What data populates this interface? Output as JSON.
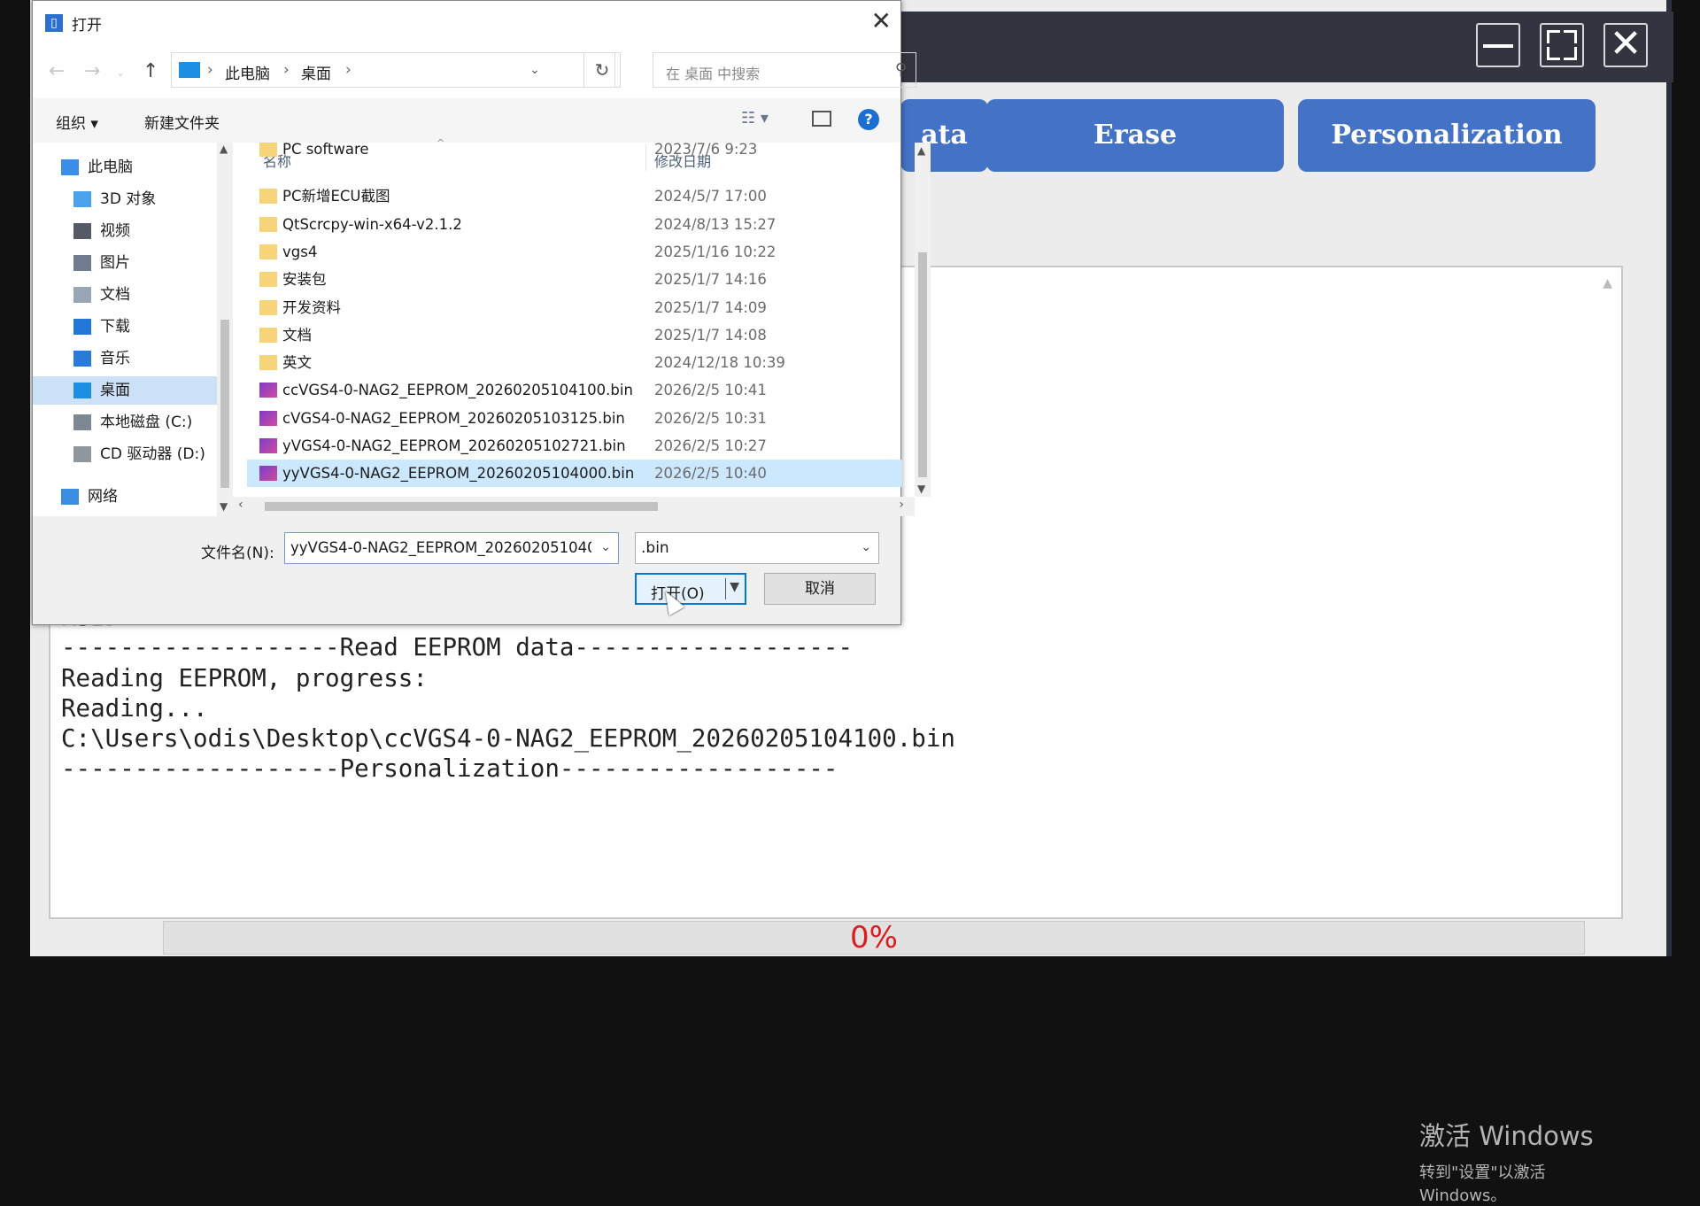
{
  "app": {
    "buttons": [
      {
        "label": "ata"
      },
      {
        "label": "Erase"
      },
      {
        "label": "Personalization"
      }
    ],
    "log_lines": [
      "RSID:            .....................................",
      "-------------------Read EEPROM data-------------------",
      "Reading EEPROM, progress:",
      "Reading...",
      "C:\\Users\\odis\\Desktop\\ccVGS4-0-NAG2_EEPROM_20260205104100.bin",
      "-------------------Personalization-------------------"
    ],
    "watermark": {
      "line1": "激活 Windows",
      "line2": "转到\"设置\"以激活 Windows。"
    },
    "progress": {
      "label": "0%",
      "value": 0
    }
  },
  "dialog": {
    "title": "打开",
    "breadcrumb": [
      "此电脑",
      "桌面"
    ],
    "search_placeholder": "在 桌面 中搜索",
    "toolbar": {
      "organize": "组织 ▾",
      "new_folder": "新建文件夹"
    },
    "nav_items": [
      {
        "label": "此电脑",
        "icon": "computer-icon",
        "color": "#3a8ee6"
      },
      {
        "label": "3D 对象",
        "icon": "cube-icon",
        "color": "#4aa3ea"
      },
      {
        "label": "视频",
        "icon": "video-icon",
        "color": "#555a66"
      },
      {
        "label": "图片",
        "icon": "picture-icon",
        "color": "#6f7d8e"
      },
      {
        "label": "文档",
        "icon": "document-icon",
        "color": "#9aa6b5"
      },
      {
        "label": "下载",
        "icon": "download-icon",
        "color": "#2277d8"
      },
      {
        "label": "音乐",
        "icon": "music-icon",
        "color": "#2a7ad8"
      },
      {
        "label": "桌面",
        "icon": "desktop-icon",
        "color": "#1e8ee3"
      },
      {
        "label": "本地磁盘 (C:)",
        "icon": "disk-icon",
        "color": "#7e8894"
      },
      {
        "label": "CD 驱动器 (D:)",
        "icon": "cd-drive-icon",
        "color": "#8f969e"
      },
      {
        "label": "网络",
        "icon": "network-icon",
        "color": "#3b8de0"
      }
    ],
    "columns": {
      "name": "名称",
      "date": "修改日期"
    },
    "files": [
      {
        "name": "PC software",
        "date": "2023/7/6 9:23",
        "type": "folder"
      },
      {
        "name": "PC新增ECU截图",
        "date": "2024/5/7 17:00",
        "type": "folder"
      },
      {
        "name": "QtScrcpy-win-x64-v2.1.2",
        "date": "2024/8/13 15:27",
        "type": "folder"
      },
      {
        "name": "vgs4",
        "date": "2025/1/16 10:22",
        "type": "folder"
      },
      {
        "name": "安装包",
        "date": "2025/1/7 14:16",
        "type": "folder"
      },
      {
        "name": "开发资料",
        "date": "2025/1/7 14:09",
        "type": "folder"
      },
      {
        "name": "文档",
        "date": "2025/1/7 14:08",
        "type": "folder"
      },
      {
        "name": "英文",
        "date": "2024/12/18 10:39",
        "type": "folder"
      },
      {
        "name": "ccVGS4-0-NAG2_EEPROM_20260205104100.bin",
        "date": "2026/2/5 10:41",
        "type": "bin"
      },
      {
        "name": "cVGS4-0-NAG2_EEPROM_20260205103125.bin",
        "date": "2026/2/5 10:31",
        "type": "bin"
      },
      {
        "name": "yVGS4-0-NAG2_EEPROM_20260205102721.bin",
        "date": "2026/2/5 10:27",
        "type": "bin"
      },
      {
        "name": "yyVGS4-0-NAG2_EEPROM_20260205104000.bin",
        "date": "2026/2/5 10:40",
        "type": "bin",
        "selected": true
      }
    ],
    "filename_label": "文件名(N):",
    "filename_value": "yyVGS4-0-NAG2_EEPROM_20260205104000.bin",
    "filetype_value": ".bin",
    "open_label": "打开(O)",
    "cancel_label": "取消"
  },
  "colors": {
    "accent": "#4472c4",
    "progress_text": "#d81e1e",
    "selection": "#cce8ff"
  }
}
